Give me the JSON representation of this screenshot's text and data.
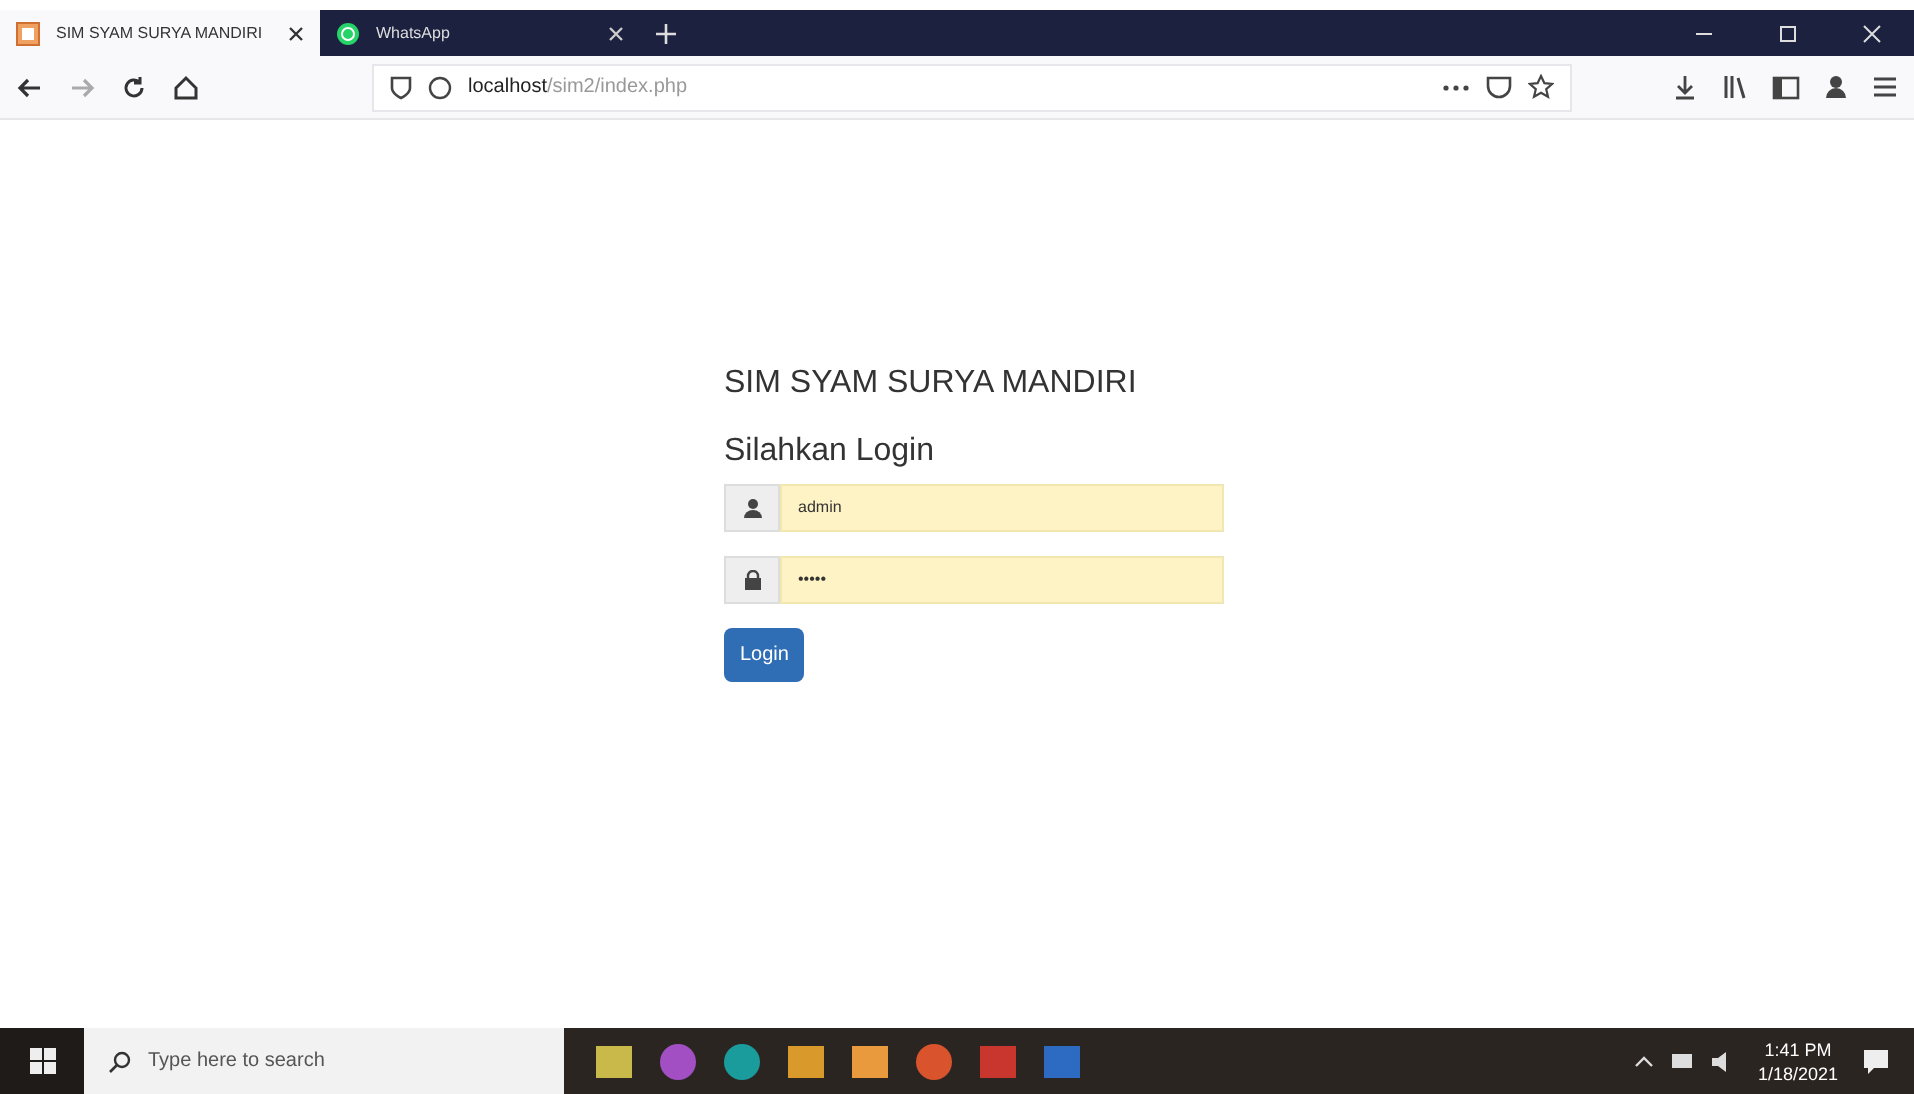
{
  "browser": {
    "tabs": [
      {
        "title": "SIM SYAM SURYA MANDIRI",
        "selected": true,
        "kind": "page"
      },
      {
        "title": "WhatsApp",
        "selected": false,
        "kind": "chat"
      }
    ],
    "address": {
      "host": "localhost",
      "path": "/sim2/index.php"
    }
  },
  "login": {
    "title": "SIM SYAM SURYA MANDIRI",
    "subtitle": "Silahkan Login",
    "fields": [
      {
        "kind": "user",
        "value": "admin"
      },
      {
        "kind": "password",
        "value": "•••••"
      }
    ],
    "button": "Login"
  },
  "taskbar": {
    "search_placeholder": "Type here to search",
    "time": "1:41 PM",
    "date": "1/18/2021"
  }
}
